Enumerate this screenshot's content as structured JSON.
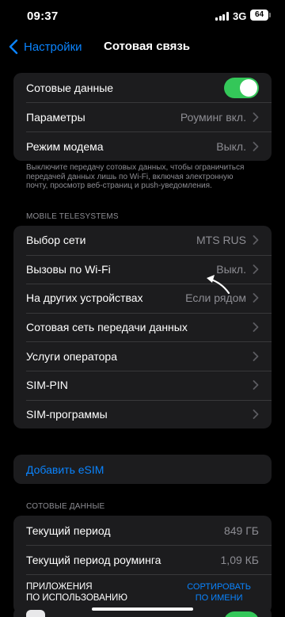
{
  "status": {
    "time": "09:37",
    "network": "3G",
    "battery": "64"
  },
  "nav": {
    "back_label": "Настройки",
    "title": "Сотовая связь"
  },
  "group_main": {
    "cellular_data": {
      "label": "Сотовые данные",
      "enabled": true
    },
    "parameters": {
      "label": "Параметры",
      "value": "Роуминг вкл."
    },
    "modem": {
      "label": "Режим модема",
      "value": "Выкл."
    }
  },
  "footnote": "Выключите передачу сотовых данных, чтобы ограничиться передачей данных лишь по Wi-Fi, включая электронную почту, просмотр веб-страниц и push-уведомления.",
  "carrier_section": {
    "header": "MOBILE TELESYSTEMS",
    "rows": [
      {
        "label": "Выбор сети",
        "value": "MTS RUS"
      },
      {
        "label": "Вызовы по Wi-Fi",
        "value": "Выкл."
      },
      {
        "label": "На других устройствах",
        "value": "Если рядом"
      },
      {
        "label": "Сотовая сеть передачи данных",
        "value": ""
      },
      {
        "label": "Услуги оператора",
        "value": ""
      },
      {
        "label": "SIM-PIN",
        "value": ""
      },
      {
        "label": "SIM-программы",
        "value": ""
      }
    ]
  },
  "esim": {
    "label": "Добавить eSIM"
  },
  "usage_section": {
    "header": "СОТОВЫЕ ДАННЫЕ",
    "current_period": {
      "label": "Текущий период",
      "value": "849 ГБ"
    },
    "roaming_period": {
      "label": "Текущий период роуминга",
      "value": "1,09 КБ"
    },
    "apps_label_line1": "ПРИЛОЖЕНИЯ",
    "apps_label_line2": "ПО ИСПОЛЬЗОВАНИЮ",
    "sort_line1": "СОРТИРОВАТЬ",
    "sort_line2": "ПО ИМЕНИ"
  },
  "colors": {
    "accent": "#0a84ff",
    "toggle_on": "#34c759",
    "cell_bg": "#1c1c1e",
    "secondary_text": "#8d8d93"
  },
  "icons": {
    "back": "chevron-left-icon",
    "disclosure": "chevron-right-icon",
    "annotation": "curved-arrow-icon"
  }
}
